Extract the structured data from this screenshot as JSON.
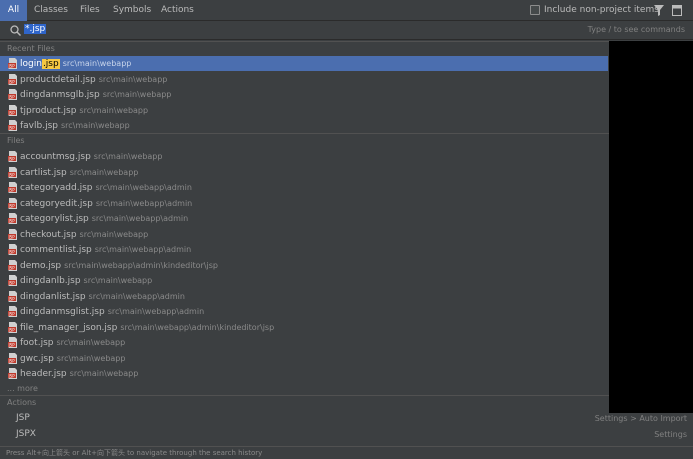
{
  "tabs": [
    {
      "label": "All",
      "active": true
    },
    {
      "label": "Classes"
    },
    {
      "label": "Files"
    },
    {
      "label": "Symbols"
    },
    {
      "label": "Actions"
    }
  ],
  "toolbar": {
    "include_label": "Include non-project items",
    "include_checked": false,
    "filter_icon": "filter-icon",
    "preview_icon": "preview-icon"
  },
  "search": {
    "value": "*.jsp",
    "hint": "Type / to see commands"
  },
  "recent": {
    "header": "Recent Files",
    "items": [
      {
        "pre": "login",
        "hl": ".jsp",
        "post": "",
        "path": "src\\main\\webapp",
        "selected": true
      },
      {
        "name": "productdetail.jsp",
        "path": "src\\main\\webapp"
      },
      {
        "name": "dingdanmsglb.jsp",
        "path": "src\\main\\webapp"
      },
      {
        "name": "tjproduct.jsp",
        "path": "src\\main\\webapp"
      },
      {
        "name": "favlb.jsp",
        "path": "src\\main\\webapp"
      }
    ]
  },
  "files": {
    "header": "Files",
    "items": [
      {
        "name": "accountmsg.jsp",
        "path": "src\\main\\webapp"
      },
      {
        "name": "cartlist.jsp",
        "path": "src\\main\\webapp"
      },
      {
        "name": "categoryadd.jsp",
        "path": "src\\main\\webapp\\admin"
      },
      {
        "name": "categoryedit.jsp",
        "path": "src\\main\\webapp\\admin"
      },
      {
        "name": "categorylist.jsp",
        "path": "src\\main\\webapp\\admin"
      },
      {
        "name": "checkout.jsp",
        "path": "src\\main\\webapp"
      },
      {
        "name": "commentlist.jsp",
        "path": "src\\main\\webapp\\admin"
      },
      {
        "name": "demo.jsp",
        "path": "src\\main\\webapp\\admin\\kindeditor\\jsp"
      },
      {
        "name": "dingdanlb.jsp",
        "path": "src\\main\\webapp"
      },
      {
        "name": "dingdanlist.jsp",
        "path": "src\\main\\webapp\\admin"
      },
      {
        "name": "dingdanmsglist.jsp",
        "path": "src\\main\\webapp\\admin"
      },
      {
        "name": "file_manager_json.jsp",
        "path": "src\\main\\webapp\\admin\\kindeditor\\jsp"
      },
      {
        "name": "foot.jsp",
        "path": "src\\main\\webapp"
      },
      {
        "name": "gwc.jsp",
        "path": "src\\main\\webapp"
      },
      {
        "name": "header.jsp",
        "path": "src\\main\\webapp"
      }
    ],
    "more_label": "... more"
  },
  "actions": {
    "header": "Actions",
    "items": [
      {
        "name": "JSP",
        "path": "Settings > Auto Import"
      },
      {
        "name": "JSPX",
        "path": "Settings"
      }
    ]
  },
  "status": "Press Alt+向上箭头 or Alt+向下箭头 to navigate through the search history",
  "colors": {
    "background": "#3c3f41",
    "selection": "#4b6eaf",
    "highlight": "#f6c842",
    "jsp_icon": "#c0392b"
  }
}
